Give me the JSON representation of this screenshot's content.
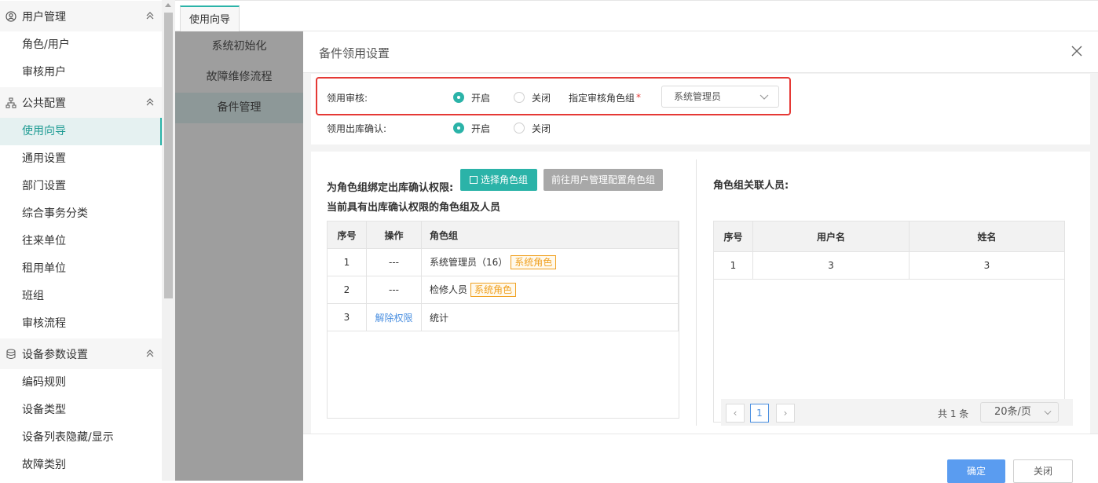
{
  "sidebar": {
    "groups": [
      {
        "label": "用户管理",
        "icon": "user-circle-icon",
        "items": [
          "角色/用户",
          "审核用户"
        ]
      },
      {
        "label": "公共配置",
        "icon": "hierarchy-icon",
        "items": [
          "使用向导",
          "通用设置",
          "部门设置",
          "综合事务分类",
          "往来单位",
          "租用单位",
          "班组",
          "审核流程"
        ]
      },
      {
        "label": "设备参数设置",
        "icon": "database-icon",
        "items": [
          "编码规则",
          "设备类型",
          "设备列表隐藏/显示",
          "故障类别"
        ]
      }
    ],
    "active_item": "使用向导"
  },
  "tabbar": {
    "tab_label": "使用向导"
  },
  "subnav": {
    "items": [
      "系统初始化",
      "故障维修流程",
      "备件管理"
    ],
    "active": "备件管理"
  },
  "modal": {
    "title": "备件领用设置",
    "approval": {
      "label": "领用审核:",
      "on_label": "开启",
      "off_label": "关闭",
      "selected": "开启",
      "role_group_label": "指定审核角色组",
      "required_mark": "*",
      "role_group_value": "系统管理员"
    },
    "confirm": {
      "label": "领用出库确认:",
      "on_label": "开启",
      "off_label": "关闭",
      "selected": "开启"
    },
    "left": {
      "bind_label": "为角色组绑定出库确认权限:",
      "select_btn": "选择角色组",
      "goto_btn": "前往用户管理配置角色组",
      "subtitle": "当前具有出库确认权限的角色组及人员",
      "headers": [
        "序号",
        "操作",
        "角色组"
      ],
      "rows": [
        {
          "no": "1",
          "op": "---",
          "role": "系统管理员（16）",
          "tag": "系统角色"
        },
        {
          "no": "2",
          "op": "---",
          "role": "检修人员",
          "tag": "系统角色"
        },
        {
          "no": "3",
          "op": "解除权限",
          "role": "统计",
          "tag": ""
        }
      ]
    },
    "right": {
      "title": "角色组关联人员:",
      "headers": [
        "序号",
        "用户名",
        "姓名"
      ],
      "rows": [
        {
          "no": "1",
          "username": "3",
          "name": "3"
        }
      ],
      "pager": {
        "page": "1",
        "total": "共 1 条",
        "page_size": "20条/页"
      }
    },
    "ok_btn": "确定",
    "close_btn": "关闭"
  },
  "colors": {
    "accent": "#2bb3a8",
    "highlight_border": "#e53935",
    "primary_button": "#5a9cf0",
    "tag": "#f0a020"
  }
}
